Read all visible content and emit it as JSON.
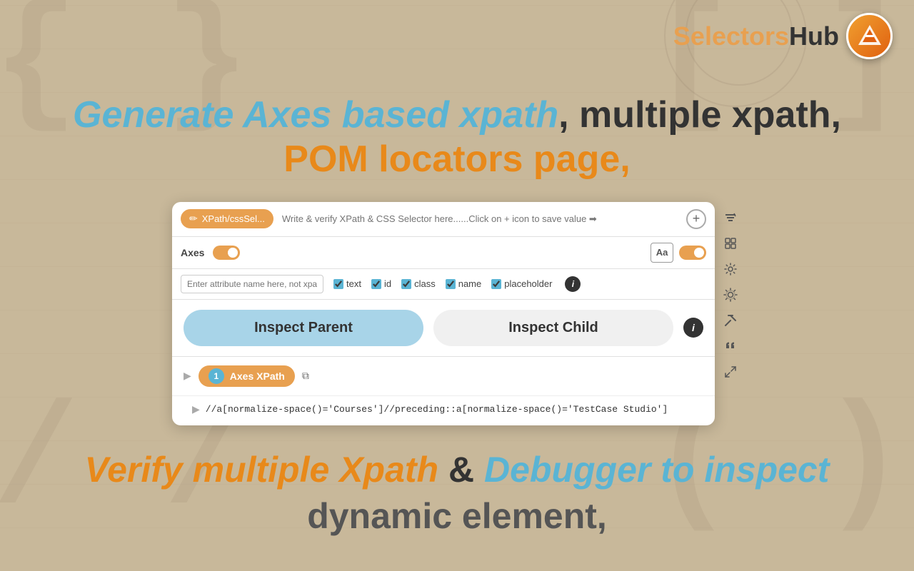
{
  "logo": {
    "selectors": "Selectors",
    "hub": "Hub"
  },
  "heading": {
    "line1_italic": "Generate Axes based xpath",
    "line1_regular": ", multiple xpath,",
    "line2": "POM locators page,"
  },
  "panel": {
    "tab_label": "XPath/cssSel...",
    "input_placeholder": "Write & verify XPath & CSS Selector here......Click on + icon to save value ➡",
    "axes_label": "Axes",
    "attribute_placeholder": "Enter attribute name here, not xpath",
    "checkboxes": [
      {
        "label": "text",
        "checked": true
      },
      {
        "label": "id",
        "checked": true
      },
      {
        "label": "class",
        "checked": true
      },
      {
        "label": "name",
        "checked": true
      },
      {
        "label": "placeholder",
        "checked": true
      }
    ],
    "inspect_parent": "Inspect Parent",
    "inspect_child": "Inspect Child",
    "result_badge": "Axes XPath",
    "result_num": "1",
    "xpath_value": "//a[normalize-space()='Courses']//preceding::a[normalize-space()='TestCase Studio']"
  },
  "bottom_heading": {
    "verify": "Verify multiple Xpath",
    "and": " & ",
    "debugger": "Debugger to inspect",
    "line2": "dynamic element,"
  },
  "icons": {
    "filter": "≡",
    "table": "⊞",
    "settings_gear": "⚙",
    "settings_gear2": "⚙",
    "tools": "✂",
    "quote": "❝",
    "expand": "⤢"
  }
}
